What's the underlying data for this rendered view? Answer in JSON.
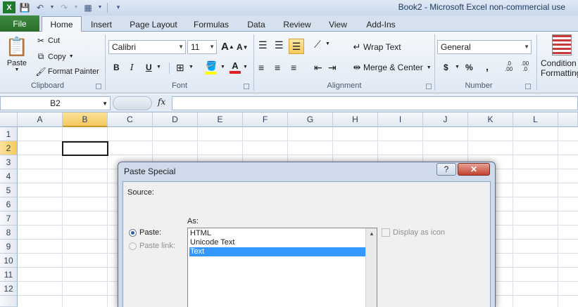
{
  "window": {
    "title": "Book2  -  Microsoft Excel non-commercial use"
  },
  "tabs": {
    "file": "File",
    "items": [
      "Home",
      "Insert",
      "Page Layout",
      "Formulas",
      "Data",
      "Review",
      "View",
      "Add-Ins"
    ]
  },
  "clipboard": {
    "paste": "Paste",
    "cut": "Cut",
    "copy": "Copy",
    "format_painter": "Format Painter",
    "label": "Clipboard"
  },
  "font": {
    "name": "Calibri",
    "size": "11",
    "bold": "B",
    "italic": "I",
    "underline": "U",
    "grow": "A",
    "shrink": "A",
    "label": "Font"
  },
  "alignment": {
    "wrap_text": "Wrap Text",
    "merge_center": "Merge & Center",
    "label": "Alignment"
  },
  "number": {
    "format": "General",
    "currency": "$",
    "percent": "%",
    "comma": ",",
    "inc_decimal": ".00",
    "dec_decimal": ".0",
    "label": "Number"
  },
  "styles": {
    "conditional": "Condition",
    "formatting": "Formatting"
  },
  "formula_bar": {
    "name_box": "B2",
    "fx": "fx"
  },
  "grid": {
    "columns": [
      "A",
      "B",
      "C",
      "D",
      "E",
      "F",
      "G",
      "H",
      "I",
      "J",
      "K",
      "L"
    ],
    "rows": [
      "1",
      "2",
      "3",
      "4",
      "5",
      "6",
      "7",
      "8",
      "9",
      "10",
      "11",
      "12"
    ],
    "selected_column": "B",
    "selected_row": "2"
  },
  "dialog": {
    "title": "Paste Special",
    "help": "?",
    "close": "✕",
    "source_label": "Source:",
    "as_label": "As:",
    "paste_label": "Paste:",
    "paste_link_label": "Paste link:",
    "options": [
      "HTML",
      "Unicode Text",
      "Text"
    ],
    "selected_option": "Text",
    "display_as_icon": "Display as icon"
  }
}
